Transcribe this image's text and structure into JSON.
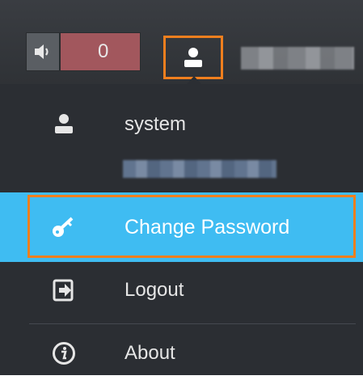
{
  "topbar": {
    "alarm_count": "0",
    "sound_icon": "speaker-icon",
    "user_icon": "user-icon"
  },
  "menu": {
    "user_name": "system",
    "items": [
      {
        "label": "Change Password",
        "icon": "key-icon",
        "selected": true
      },
      {
        "label": "Logout",
        "icon": "logout-icon"
      },
      {
        "label": "About",
        "icon": "info-icon"
      }
    ]
  },
  "colors": {
    "highlight": "#3fbcf2",
    "focus_outline": "#f07f1e",
    "alarm_bg": "#a2575d",
    "menu_bg": "#2b2e33"
  }
}
